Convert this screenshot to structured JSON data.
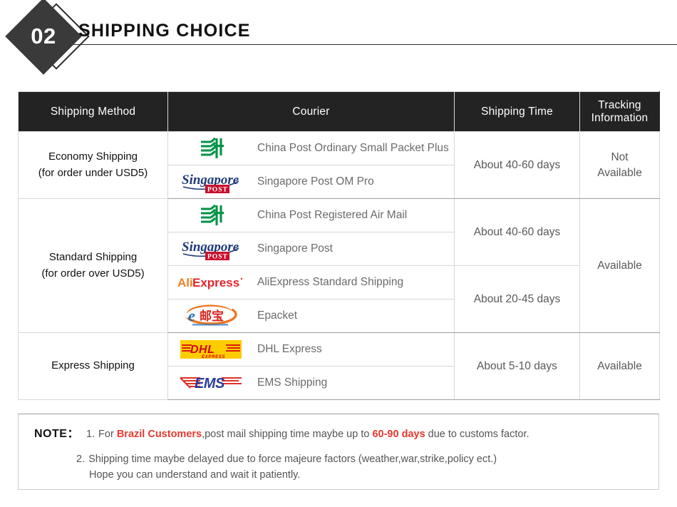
{
  "section": {
    "number": "02",
    "title": "SHIPPING CHOICE"
  },
  "table": {
    "headers": {
      "method": "Shipping Method",
      "courier": "Courier",
      "time": "Shipping Time",
      "tracking_line1": "Tracking",
      "tracking_line2": "Information"
    },
    "groups": [
      {
        "method_line1": "Economy Shipping",
        "method_line2": "(for order under USD5)",
        "couriers": [
          {
            "logo": "china-post-logo",
            "name": "China Post Ordinary Small Packet Plus"
          },
          {
            "logo": "singapore-post-logo",
            "name": "Singapore Post OM Pro"
          }
        ],
        "times": [
          {
            "label": "About 40-60 days",
            "rows": 2
          }
        ],
        "tracking_line1": "Not",
        "tracking_line2": "Available"
      },
      {
        "method_line1": "Standard Shipping",
        "method_line2": "(for order over USD5)",
        "couriers": [
          {
            "logo": "china-post-logo",
            "name": "China Post Registered Air Mail"
          },
          {
            "logo": "singapore-post-logo",
            "name": "Singapore Post"
          },
          {
            "logo": "aliexpress-logo",
            "name": "AliExpress Standard Shipping"
          },
          {
            "logo": "epacket-logo",
            "name": "Epacket"
          }
        ],
        "times": [
          {
            "label": "About 40-60 days",
            "rows": 2
          },
          {
            "label": "About 20-45 days",
            "rows": 2
          }
        ],
        "tracking": "Available"
      },
      {
        "method_line1": "Express Shipping",
        "method_line2": "",
        "couriers": [
          {
            "logo": "dhl-logo",
            "name": "DHL Express"
          },
          {
            "logo": "ems-logo",
            "name": "EMS Shipping"
          }
        ],
        "times": [
          {
            "label": "About 5-10 days",
            "rows": 2
          }
        ],
        "tracking": "Available"
      }
    ]
  },
  "note": {
    "label": "NOTE：",
    "item1": {
      "num": "1.",
      "part1": "For ",
      "highlight1": "Brazil Customers",
      "part2": ",post mail shipping time maybe up to ",
      "highlight2": "60-90 days",
      "part3": " due to customs factor."
    },
    "item2": {
      "num": "2.",
      "line1": "Shipping time maybe delayed due to force majeure factors (weather,war,strike,policy ect.)",
      "line2": "Hope you can understand and wait it patiently."
    }
  },
  "colors": {
    "header_bg": "#232323",
    "china_post_green": "#009345",
    "singapore_navy": "#1F3A7A",
    "singapore_red": "#C8102E",
    "aliexpress_orange": "#F08021",
    "aliexpress_red": "#E42529",
    "epacket_orange": "#EE7623",
    "epacket_blue": "#1B6FB5",
    "epacket_red": "#D9231F",
    "dhl_yellow": "#FFCC00",
    "dhl_red": "#D40511",
    "ems_blue": "#2B3A9B",
    "ems_red": "#E03127",
    "note_red": "#E8392F"
  }
}
